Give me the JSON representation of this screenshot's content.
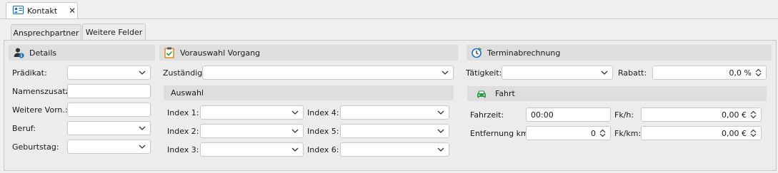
{
  "window": {
    "doc_tab": "Kontakt"
  },
  "tabs": [
    {
      "label": "Ansprechpartner",
      "active": false
    },
    {
      "label": "Weitere Felder",
      "active": true
    }
  ],
  "details": {
    "title": "Details",
    "fields": [
      {
        "label": "Prädikat:",
        "value": ""
      },
      {
        "label": "Namenszusatz:",
        "value": ""
      },
      {
        "label": "Weitere Vorn.:",
        "value": ""
      },
      {
        "label": "Beruf:",
        "value": ""
      },
      {
        "label": "Geburtstag:",
        "value": ""
      }
    ]
  },
  "vorauswahl": {
    "title": "Vorauswahl Vorgang",
    "zustandig_label": "Zuständig:",
    "zustandig_value": "",
    "auswahl_title": "Auswahl",
    "indexes": [
      {
        "label": "Index 1:",
        "value": ""
      },
      {
        "label": "Index 2:",
        "value": ""
      },
      {
        "label": "Index 3:",
        "value": ""
      },
      {
        "label": "Index 4:",
        "value": ""
      },
      {
        "label": "Index 5:",
        "value": ""
      },
      {
        "label": "Index 6:",
        "value": ""
      }
    ]
  },
  "termin": {
    "title": "Terminabrechnung",
    "taetigkeit_label": "Tätigkeit:",
    "taetigkeit_value": "",
    "rabatt_label": "Rabatt:",
    "rabatt_value": "0,0 %",
    "fahrt_title": "Fahrt",
    "fahrzeit_label": "Fahrzeit:",
    "fahrzeit_value": "00:00",
    "entfernung_label": "Entfernung km:",
    "entfernung_value": "0",
    "fkh_label": "Fk/h:",
    "fkh_value": "0,00 €",
    "fkkm_label": "Fk/km:",
    "fkkm_value": "0,00 €"
  },
  "colors": {
    "accent_blue": "#1f6fbf",
    "accent_green": "#2e9a47",
    "accent_orange": "#e08a1e"
  }
}
